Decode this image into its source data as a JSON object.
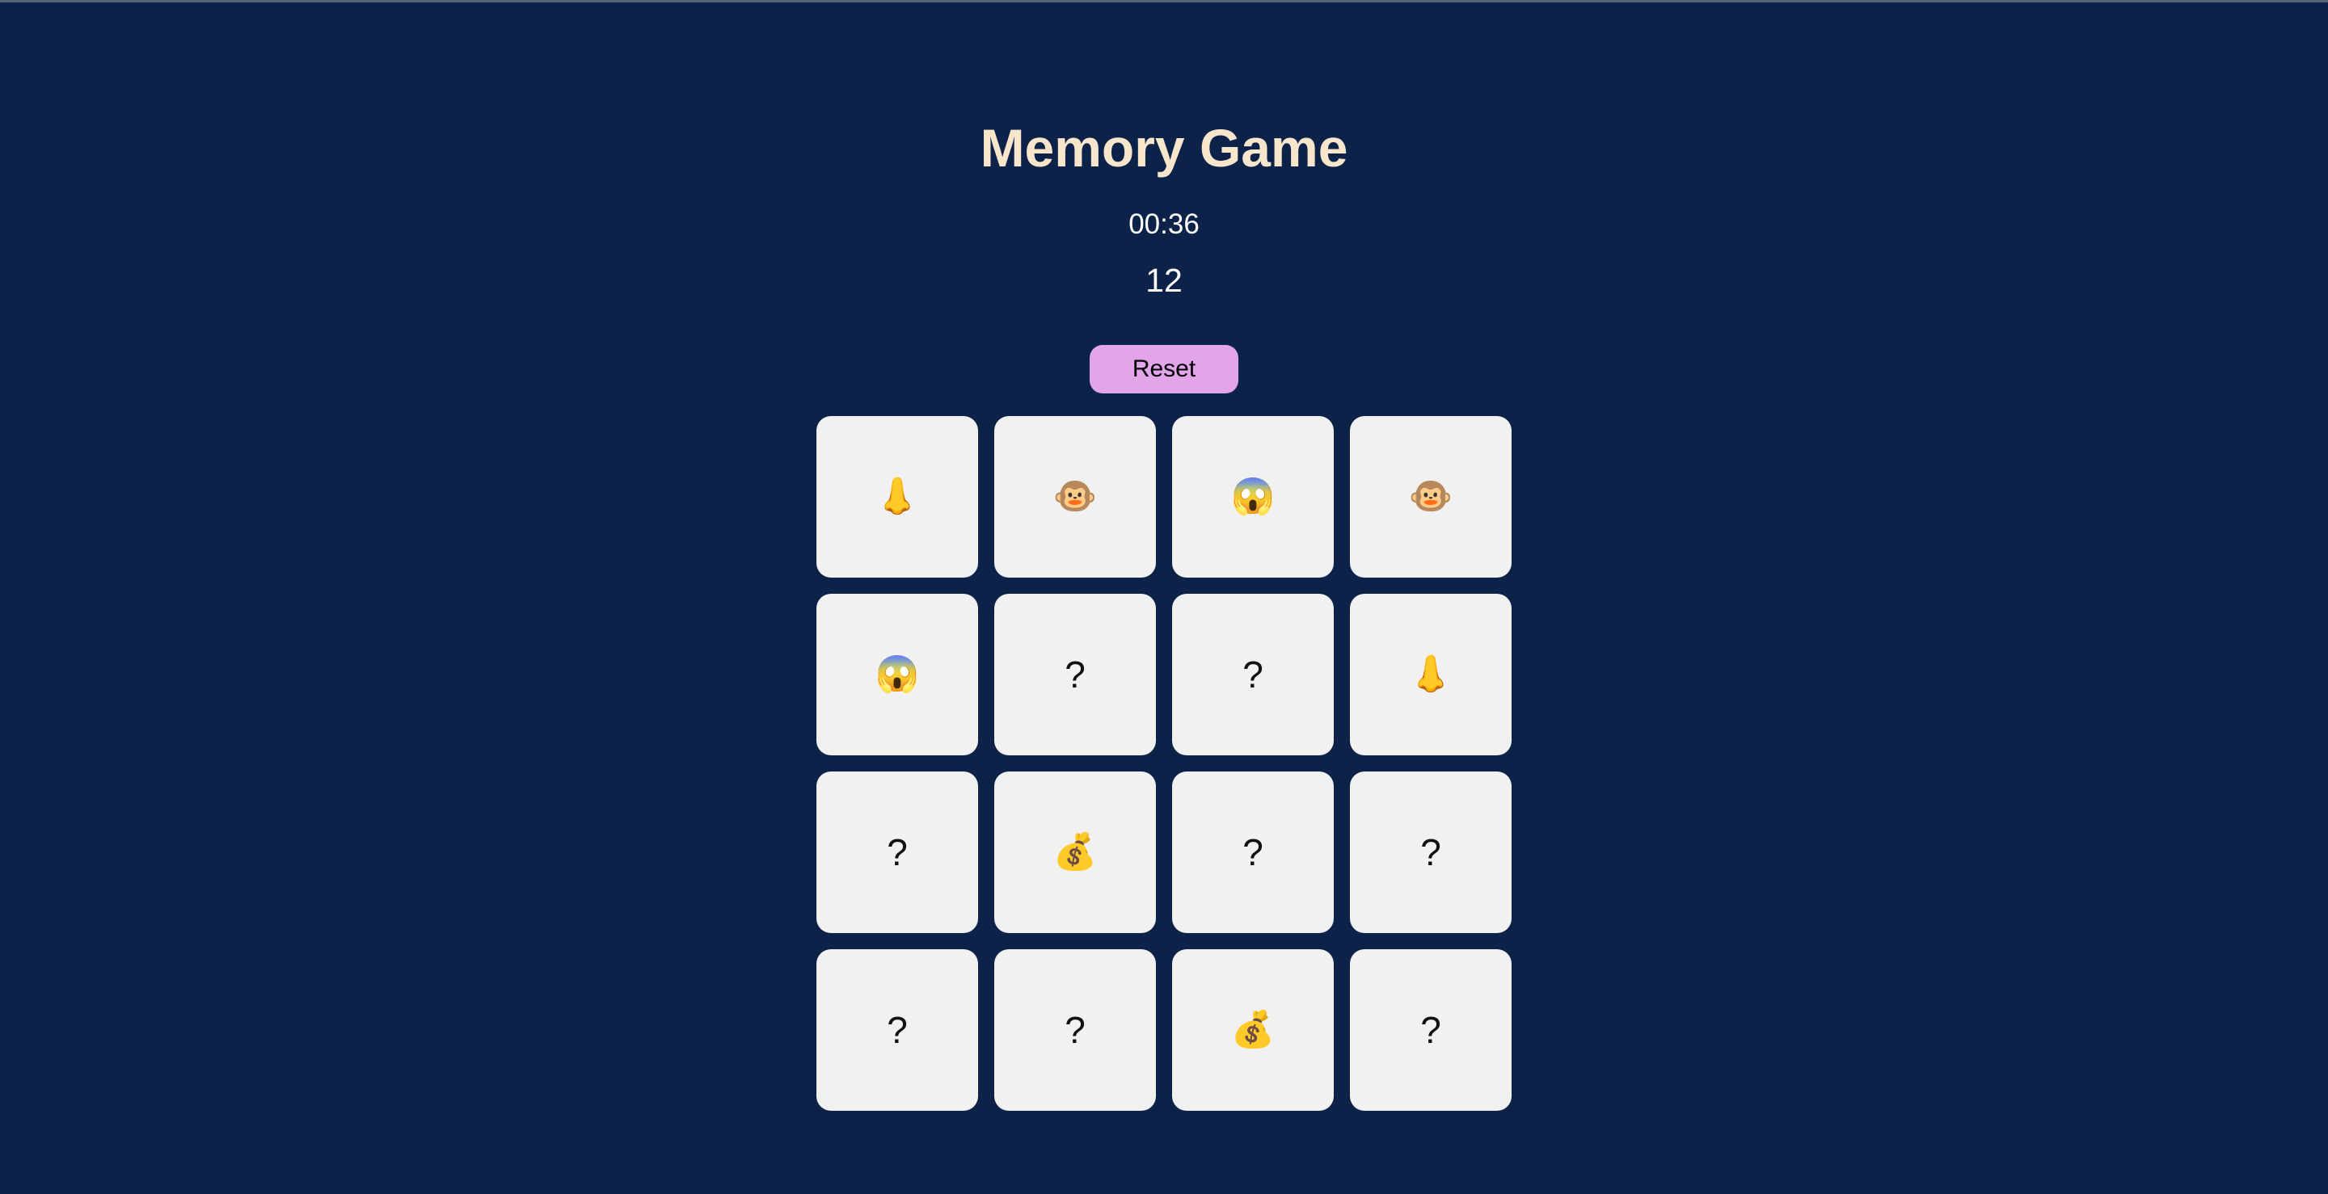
{
  "game": {
    "title": "Memory Game",
    "timer": "00:36",
    "moves": "12",
    "reset_label": "Reset"
  },
  "cards": [
    {
      "face": "👃",
      "state": "revealed",
      "icon": "nose-icon"
    },
    {
      "face": "🐵",
      "state": "revealed",
      "icon": "monkey-face-icon"
    },
    {
      "face": "😱",
      "state": "revealed",
      "icon": "screaming-face-icon"
    },
    {
      "face": "🐵",
      "state": "revealed",
      "icon": "monkey-face-icon"
    },
    {
      "face": "😱",
      "state": "revealed",
      "icon": "screaming-face-icon"
    },
    {
      "face": "?",
      "state": "hidden",
      "icon": "question-mark-icon"
    },
    {
      "face": "?",
      "state": "hidden",
      "icon": "question-mark-icon"
    },
    {
      "face": "👃",
      "state": "revealed",
      "icon": "nose-icon"
    },
    {
      "face": "?",
      "state": "hidden",
      "icon": "question-mark-icon"
    },
    {
      "face": "💰",
      "state": "revealed",
      "icon": "money-bag-icon"
    },
    {
      "face": "?",
      "state": "hidden",
      "icon": "question-mark-icon"
    },
    {
      "face": "?",
      "state": "hidden",
      "icon": "question-mark-icon"
    },
    {
      "face": "?",
      "state": "hidden",
      "icon": "question-mark-icon"
    },
    {
      "face": "?",
      "state": "hidden",
      "icon": "question-mark-icon"
    },
    {
      "face": "💰",
      "state": "revealed",
      "icon": "money-bag-icon"
    },
    {
      "face": "?",
      "state": "hidden",
      "icon": "question-mark-icon"
    }
  ],
  "colors": {
    "background": "#0d2249",
    "title": "#f8e6cc",
    "text": "#ffffff",
    "button": "#e2a5ea",
    "card": "#f1f1f1"
  }
}
